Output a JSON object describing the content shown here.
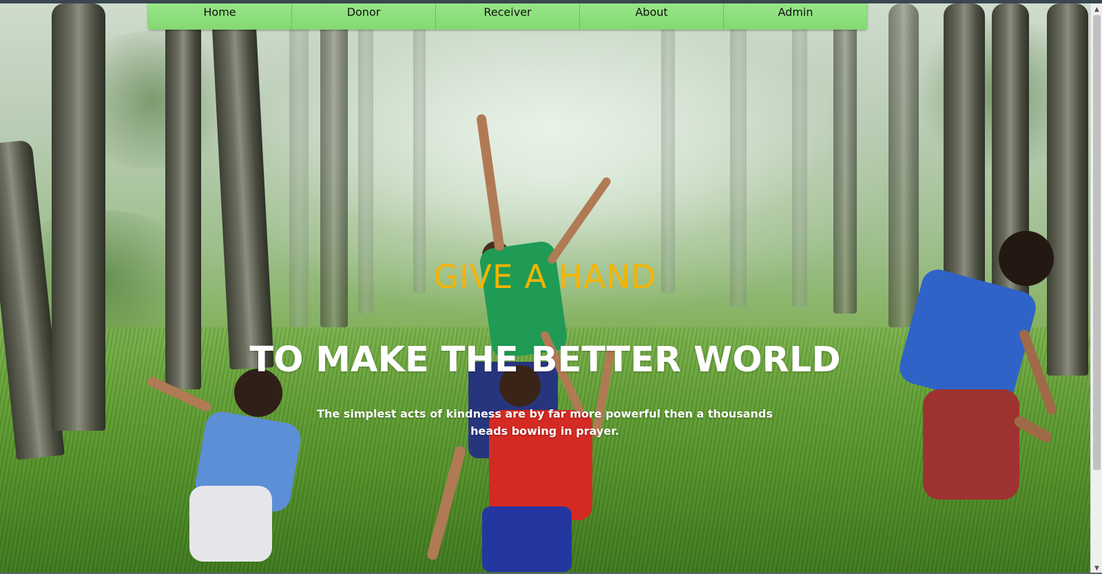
{
  "nav": {
    "items": [
      {
        "label": "Home"
      },
      {
        "label": "Donor"
      },
      {
        "label": "Receiver"
      },
      {
        "label": "About"
      },
      {
        "label": "Admin"
      }
    ]
  },
  "hero": {
    "title": "GIVE A HAND",
    "heading": "TO MAKE THE BETTER WORLD",
    "tagline": "The simplest acts of kindness are by far more powerful then a thousands heads bowing in prayer."
  },
  "colors": {
    "nav_background": "#8fe07f",
    "title": "#f5b400",
    "heading": "#ffffff"
  },
  "icons": {
    "scroll_up": "scroll-up-arrow-icon",
    "scroll_down": "scroll-down-arrow-icon"
  }
}
